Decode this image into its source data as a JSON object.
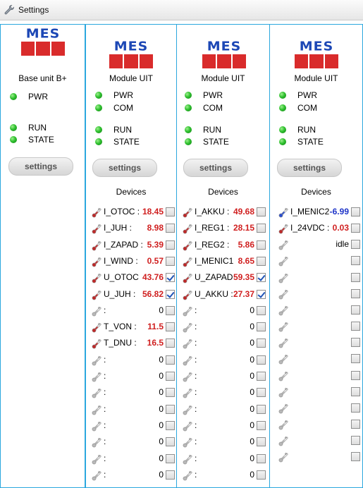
{
  "window": {
    "title": "Settings",
    "icon": "wrench-icon"
  },
  "base": {
    "title": "Base unit B+",
    "leds": [
      "PWR",
      "RUN",
      "STATE"
    ],
    "settings_label": "settings"
  },
  "modules": [
    {
      "title": "Module UIT",
      "leds": [
        "PWR",
        "COM",
        "RUN",
        "STATE"
      ],
      "settings_label": "settings",
      "devices_label": "Devices",
      "devices": [
        {
          "icon": "thermometer-red-icon",
          "name": "I_OTOC :",
          "value": "18.45",
          "color": "red",
          "checked": false
        },
        {
          "icon": "thermometer-red-icon",
          "name": "I_JUH :",
          "value": "8.98",
          "color": "red",
          "checked": false
        },
        {
          "icon": "thermometer-red-icon",
          "name": "I_ZAPAD :",
          "value": "5.39",
          "color": "red",
          "checked": false
        },
        {
          "icon": "thermometer-red-icon",
          "name": "I_WIND :",
          "value": "0.57",
          "color": "red",
          "checked": false
        },
        {
          "icon": "thermometer-red-icon",
          "name": "U_OTOC",
          "value": "43.76",
          "color": "red",
          "checked": true
        },
        {
          "icon": "thermometer-red-icon",
          "name": "U_JUH :",
          "value": "56.82",
          "color": "red",
          "checked": true
        },
        {
          "icon": "thermometer-gray-icon",
          "name": ":",
          "value": "0",
          "color": "plain",
          "checked": false
        },
        {
          "icon": "thermometer-red-icon",
          "name": "T_VON :",
          "value": "11.5",
          "color": "red",
          "checked": false
        },
        {
          "icon": "thermometer-red-icon",
          "name": "T_DNU :",
          "value": "16.5",
          "color": "red",
          "checked": false
        },
        {
          "icon": "thermometer-gray-icon",
          "name": ":",
          "value": "0",
          "color": "plain",
          "checked": false
        },
        {
          "icon": "thermometer-gray-icon",
          "name": ":",
          "value": "0",
          "color": "plain",
          "checked": false
        },
        {
          "icon": "thermometer-gray-icon",
          "name": ":",
          "value": "0",
          "color": "plain",
          "checked": false
        },
        {
          "icon": "thermometer-gray-icon",
          "name": ":",
          "value": "0",
          "color": "plain",
          "checked": false
        },
        {
          "icon": "thermometer-gray-icon",
          "name": ":",
          "value": "0",
          "color": "plain",
          "checked": false
        },
        {
          "icon": "thermometer-gray-icon",
          "name": ":",
          "value": "0",
          "color": "plain",
          "checked": false
        },
        {
          "icon": "thermometer-gray-icon",
          "name": ":",
          "value": "0",
          "color": "plain",
          "checked": false
        },
        {
          "icon": "thermometer-gray-icon",
          "name": ":",
          "value": "0",
          "color": "plain",
          "checked": false
        }
      ]
    },
    {
      "title": "Module UIT",
      "leds": [
        "PWR",
        "COM",
        "RUN",
        "STATE"
      ],
      "settings_label": "settings",
      "devices_label": "Devices",
      "devices": [
        {
          "icon": "thermometer-red-icon",
          "name": "I_AKKU :",
          "value": "49.68",
          "color": "red",
          "checked": false
        },
        {
          "icon": "thermometer-red-icon",
          "name": "I_REG1 :",
          "value": "28.15",
          "color": "red",
          "checked": false
        },
        {
          "icon": "thermometer-red-icon",
          "name": "I_REG2 :",
          "value": "5.86",
          "color": "red",
          "checked": false
        },
        {
          "icon": "thermometer-red-icon",
          "name": "I_MENIC1",
          "value": "8.65",
          "color": "red",
          "checked": false
        },
        {
          "icon": "thermometer-red-icon",
          "name": "U_ZAPAD",
          "value": "59.35",
          "color": "red",
          "checked": true
        },
        {
          "icon": "thermometer-red-icon",
          "name": "U_AKKU :",
          "value": "27.37",
          "color": "red",
          "checked": true
        },
        {
          "icon": "thermometer-gray-icon",
          "name": ":",
          "value": "0",
          "color": "plain",
          "checked": false
        },
        {
          "icon": "thermometer-gray-icon",
          "name": ":",
          "value": "0",
          "color": "plain",
          "checked": false
        },
        {
          "icon": "thermometer-gray-icon",
          "name": ":",
          "value": "0",
          "color": "plain",
          "checked": false
        },
        {
          "icon": "thermometer-gray-icon",
          "name": ":",
          "value": "0",
          "color": "plain",
          "checked": false
        },
        {
          "icon": "thermometer-gray-icon",
          "name": ":",
          "value": "0",
          "color": "plain",
          "checked": false
        },
        {
          "icon": "thermometer-gray-icon",
          "name": ":",
          "value": "0",
          "color": "plain",
          "checked": false
        },
        {
          "icon": "thermometer-gray-icon",
          "name": ":",
          "value": "0",
          "color": "plain",
          "checked": false
        },
        {
          "icon": "thermometer-gray-icon",
          "name": ":",
          "value": "0",
          "color": "plain",
          "checked": false
        },
        {
          "icon": "thermometer-gray-icon",
          "name": ":",
          "value": "0",
          "color": "plain",
          "checked": false
        },
        {
          "icon": "thermometer-gray-icon",
          "name": ":",
          "value": "0",
          "color": "plain",
          "checked": false
        },
        {
          "icon": "thermometer-gray-icon",
          "name": ":",
          "value": "0",
          "color": "plain",
          "checked": false
        }
      ]
    },
    {
      "title": "Module UIT",
      "leds": [
        "PWR",
        "COM",
        "RUN",
        "STATE"
      ],
      "settings_label": "settings",
      "devices_label": "Devices",
      "devices": [
        {
          "icon": "thermometer-blue-icon",
          "name": "I_MENIC2",
          "value": "-6.99",
          "color": "blue",
          "checked": false
        },
        {
          "icon": "thermometer-red-icon",
          "name": "I_24VDC :",
          "value": "0.03",
          "color": "red",
          "checked": false
        },
        {
          "icon": "thermometer-gray-icon",
          "name": "",
          "value": "idle",
          "color": "plain",
          "checked": false
        },
        {
          "icon": "thermometer-gray-icon",
          "name": "",
          "value": "",
          "color": "plain",
          "checked": false
        },
        {
          "icon": "thermometer-gray-icon",
          "name": "",
          "value": "",
          "color": "plain",
          "checked": false
        },
        {
          "icon": "thermometer-gray-icon",
          "name": "",
          "value": "",
          "color": "plain",
          "checked": false
        },
        {
          "icon": "thermometer-gray-icon",
          "name": "",
          "value": "",
          "color": "plain",
          "checked": false
        },
        {
          "icon": "thermometer-gray-icon",
          "name": "",
          "value": "",
          "color": "plain",
          "checked": false
        },
        {
          "icon": "thermometer-gray-icon",
          "name": "",
          "value": "",
          "color": "plain",
          "checked": false
        },
        {
          "icon": "thermometer-gray-icon",
          "name": "",
          "value": "",
          "color": "plain",
          "checked": false
        },
        {
          "icon": "thermometer-gray-icon",
          "name": "",
          "value": "",
          "color": "plain",
          "checked": false
        },
        {
          "icon": "thermometer-gray-icon",
          "name": "",
          "value": "",
          "color": "plain",
          "checked": false
        },
        {
          "icon": "thermometer-gray-icon",
          "name": "",
          "value": "",
          "color": "plain",
          "checked": false
        },
        {
          "icon": "thermometer-gray-icon",
          "name": "",
          "value": "",
          "color": "plain",
          "checked": false
        },
        {
          "icon": "thermometer-gray-icon",
          "name": "",
          "value": "",
          "color": "plain",
          "checked": false
        },
        {
          "icon": "thermometer-gray-icon",
          "name": "",
          "value": "",
          "color": "plain",
          "checked": false
        }
      ]
    }
  ],
  "logo_text": "MES",
  "colors": {
    "accent": "#2ba7de",
    "value_red": "#d02020",
    "value_blue": "#1f35c8",
    "logo_blue": "#1c47b5",
    "logo_red": "#d92b2b"
  }
}
